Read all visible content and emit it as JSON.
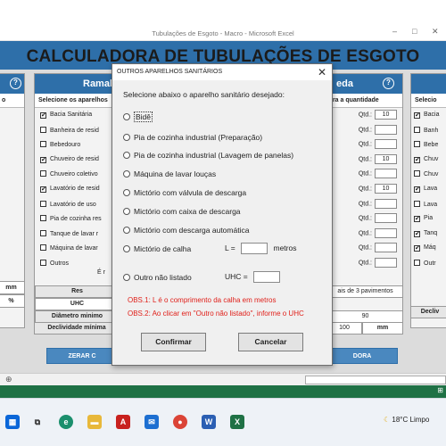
{
  "window": {
    "title": "Tubulações de Esgoto - Macro - Microsoft Excel",
    "minimize": "–",
    "maximize": "□",
    "close": "✕"
  },
  "sheet": {
    "main_title": "CALCULADORA DE TUBULAÇÕES DE ESGOTO",
    "left_panel": {
      "heading": "Ramal",
      "help": "?",
      "select_label": "Selecione os aparelhos",
      "items": [
        {
          "label": "Bacia Sanitária",
          "checked": "✔"
        },
        {
          "label": "Banheira de resid",
          "checked": ""
        },
        {
          "label": "Bebedouro",
          "checked": ""
        },
        {
          "label": "Chuveiro de resid",
          "checked": "✔"
        },
        {
          "label": "Chuveiro coletivo",
          "checked": ""
        },
        {
          "label": "Lavatório de resid",
          "checked": "✔"
        },
        {
          "label": "Lavatório de uso",
          "checked": ""
        },
        {
          "label": "Pia de cozinha res",
          "checked": ""
        },
        {
          "label": "Tanque de lavar r",
          "checked": ""
        },
        {
          "label": "Máquina de lavar",
          "checked": ""
        },
        {
          "label": "Outros",
          "checked": ""
        }
      ],
      "others_suffix": "É r",
      "summary_label": "Res",
      "uhc_label": "UHC",
      "diametro_label": "Diâmetro minimo",
      "declividade_label": "Declividade mínima",
      "zerar_button": "ZERAR C"
    },
    "right_panel": {
      "heading": "eda",
      "help": "?",
      "qty_header": "ira a quantidade",
      "qty_label": "Qtd.:",
      "quantities": [
        "10",
        "",
        "",
        "10",
        "",
        "10",
        "",
        "",
        "",
        "",
        ""
      ],
      "pavimentos_text": "ais de 3 pavimentos",
      "diametro_value": "90",
      "declividade_value": "100",
      "declividade_unit": "mm",
      "calc_button": "DORA"
    },
    "far_left": {
      "help": "?",
      "sub": "o",
      "unit_mm": "mm",
      "unit_pct": "%"
    },
    "far_right": {
      "sub": "Selecio",
      "items": [
        {
          "label": "Bacia",
          "checked": "✔"
        },
        {
          "label": "Banh",
          "checked": ""
        },
        {
          "label": "Bebe",
          "checked": ""
        },
        {
          "label": "Chuv",
          "checked": "✔"
        },
        {
          "label": "Chuv",
          "checked": ""
        },
        {
          "label": "Lava",
          "checked": "✔"
        },
        {
          "label": "Lava",
          "checked": ""
        },
        {
          "label": "Pia",
          "checked": "✔"
        },
        {
          "label": "Tanq",
          "checked": "✔"
        },
        {
          "label": "Máq",
          "checked": "✔"
        },
        {
          "label": "Outr",
          "checked": ""
        }
      ],
      "declividade_label": "Decliv"
    }
  },
  "statusbar": {
    "add_sheet": "⊕",
    "right_glyph": "⊞"
  },
  "taskbar": {
    "weather": "18°C  Limpo",
    "icons": [
      "start",
      "task-view",
      "edge",
      "file-explorer",
      "acrobat",
      "mail",
      "chrome",
      "word",
      "excel"
    ]
  },
  "dialog": {
    "title": "OUTROS APARELHOS SANITÁRIOS",
    "close": "✕",
    "instruction": "Selecione abaixo o aparelho sanitário desejado:",
    "options": [
      "Bidê",
      "Pia de cozinha industrial (Preparação)",
      "Pia de cozinha industrial (Lavagem de panelas)",
      "Máquina de lavar louças",
      "Mictório com válvula de descarga",
      "Mictório com caixa de descarga",
      "Mictório com descarga automática",
      "Mictório de calha",
      "Outro não listado"
    ],
    "calha_l_label": "L =",
    "calha_unit": "metros",
    "calha_value": "",
    "uhc_label": "UHC =",
    "uhc_value": "",
    "note1": "OBS.1: L é o comprimento da calha em metros",
    "note2": "OBS.2: Ao clicar em \"Outro não listado\", informe o UHC",
    "confirm": "Confirmar",
    "cancel": "Cancelar",
    "accent_note_color": "#e0201a"
  }
}
